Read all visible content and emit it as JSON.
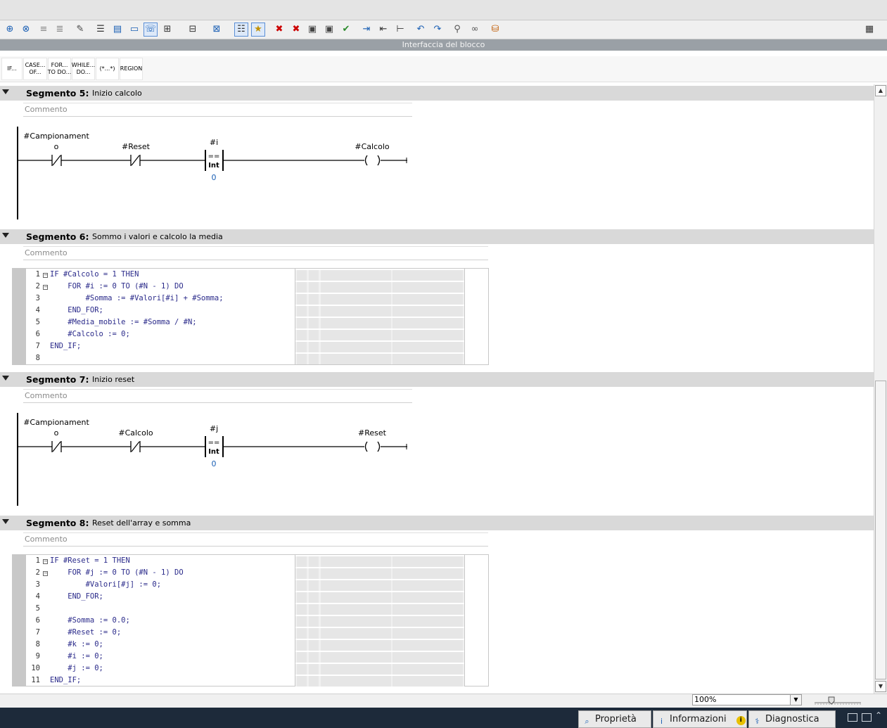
{
  "interface_label": "Interfaccia del blocco",
  "scl_buttons": [
    {
      "label": "IF...",
      "name": "if"
    },
    {
      "label": "CASE...\nOF...",
      "name": "case-of"
    },
    {
      "label": "FOR...\nTO DO...",
      "name": "for-to-do"
    },
    {
      "label": "WHILE...\nDO...",
      "name": "while-do"
    },
    {
      "label": "(*...*)",
      "name": "comment-block"
    },
    {
      "label": "REGION",
      "name": "region"
    }
  ],
  "toolbar_icons": [
    "insert-network-icon",
    "delete-network-icon",
    "insert-row-icon",
    "add-row-icon",
    "edit-icon",
    "list-icon",
    "window-icon",
    "box-icon",
    "speech-icon",
    "contact-icon",
    "coil-icon",
    "box-import-icon",
    "list-view-icon",
    "star-list-icon",
    "remove-icon",
    "remove-all-icon",
    "monitor-icon",
    "monitor-all-icon",
    "check-icon",
    "indent-icon",
    "outdent-icon",
    "tree-icon",
    "goto-prev-icon",
    "goto-next-icon",
    "watch-icon",
    "glasses-icon",
    "db-icon"
  ],
  "segments": [
    {
      "title": "Segmento 5:",
      "name": "Inizio calcolo",
      "comment": "Commento",
      "type": "ladder",
      "contact1_line1": "#Campionament",
      "contact1_line2": "o",
      "contact2": "#Reset",
      "cmp_var": "#i",
      "cmp_op": "==",
      "cmp_type": "Int",
      "cmp_value": "0",
      "coil": "#Calcolo"
    },
    {
      "title": "Segmento 6:",
      "name": "Sommo i valori e calcolo la media",
      "comment": "Commento",
      "type": "scl",
      "lines": [
        "IF #Calcolo = 1 THEN",
        "    FOR #i := 0 TO (#N - 1) DO",
        "        #Somma := #Valori[#i] + #Somma;",
        "    END_FOR;",
        "    #Media_mobile := #Somma / #N;",
        "    #Calcolo := 0;",
        "END_IF;",
        ""
      ],
      "line_numbers": [
        "1",
        "2",
        "3",
        "4",
        "5",
        "6",
        "7",
        "8"
      ]
    },
    {
      "title": "Segmento 7:",
      "name": "Inizio reset",
      "comment": "Commento",
      "type": "ladder",
      "contact1_line1": "#Campionament",
      "contact1_line2": "o",
      "contact2": "#Calcolo",
      "cmp_var": "#j",
      "cmp_op": "==",
      "cmp_type": "Int",
      "cmp_value": "0",
      "coil": "#Reset"
    },
    {
      "title": "Segmento 8:",
      "name": "Reset dell'array e somma",
      "comment": "Commento",
      "type": "scl",
      "lines": [
        "IF #Reset = 1 THEN",
        "    FOR #j := 0 TO (#N - 1) DO",
        "        #Valori[#j] := 0;",
        "    END_FOR;",
        "",
        "    #Somma := 0.0;",
        "    #Reset := 0;",
        "    #k := 0;",
        "    #i := 0;",
        "    #j := 0;",
        "END_IF;"
      ],
      "line_numbers": [
        "1",
        "2",
        "3",
        "4",
        "5",
        "6",
        "7",
        "8",
        "9",
        "10",
        "11"
      ]
    }
  ],
  "zoom": {
    "value": "100%"
  },
  "bottom_tabs": [
    {
      "label": "Proprietà",
      "icon": "properties-icon"
    },
    {
      "label": "Informazioni",
      "icon": "info-icon"
    },
    {
      "label": "Diagnostica",
      "icon": "diagnostics-icon"
    }
  ],
  "colors": {
    "accent": "#1a5fb4",
    "segment_header": "#d9d9d9",
    "status_bar": "#1d2a3a"
  }
}
